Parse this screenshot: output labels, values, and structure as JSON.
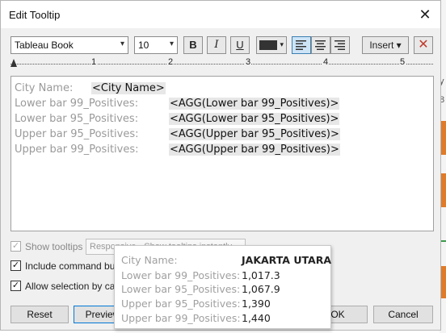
{
  "dialog": {
    "title": "Edit Tooltip"
  },
  "toolbar": {
    "font_family": "Tableau Book",
    "font_size": "10",
    "bold_label": "B",
    "italic_label": "I",
    "underline_label": "U",
    "font_color": "#333333",
    "insert_label": "Insert ▾"
  },
  "ruler": {
    "marks": [
      "1",
      "2",
      "3",
      "4",
      "5"
    ]
  },
  "editor": {
    "lines": [
      {
        "label": "City Name:",
        "field": "<City Name>"
      },
      {
        "label": "Lower bar 99_Positives:",
        "field": "<AGG(Lower bar 99_Positives)>"
      },
      {
        "label": "Lower bar 95_Positives:",
        "field": "<AGG(Lower bar 95_Positives)>"
      },
      {
        "label": "Upper bar 95_Positives:",
        "field": "<AGG(Upper bar 95_Positives)>"
      },
      {
        "label": "Upper bar 99_Positives:",
        "field": "<AGG(Upper bar 99_Positives)>"
      }
    ]
  },
  "options": {
    "show_tooltips": {
      "label": "Show tooltips",
      "checked": true,
      "enabled": false
    },
    "responsive_select": "Responsive - Show tooltips instantly",
    "include_command_buttons": {
      "label": "Include command butto",
      "checked": true
    },
    "allow_selection": {
      "label": "Allow selection by categ",
      "checked": true
    }
  },
  "buttons": {
    "reset": "Reset",
    "preview": "Preview",
    "ok": "OK",
    "cancel": "Cancel"
  },
  "preview_tooltip": {
    "rows": [
      {
        "label": "City Name:",
        "value": "JAKARTA UTARA"
      },
      {
        "label": "Lower bar 99_Positives:",
        "value": "1,017.3"
      },
      {
        "label": "Lower bar 95_Positives:",
        "value": "1,067.9"
      },
      {
        "label": "Upper bar 95_Positives:",
        "value": "1,390"
      },
      {
        "label": "Upper bar 99_Positives:",
        "value": "1,440"
      }
    ]
  },
  "background": {
    "text_1": "y",
    "text_2": "8",
    "bar_color": "#e07b2a",
    "accent_green": "#3a9a4a"
  }
}
